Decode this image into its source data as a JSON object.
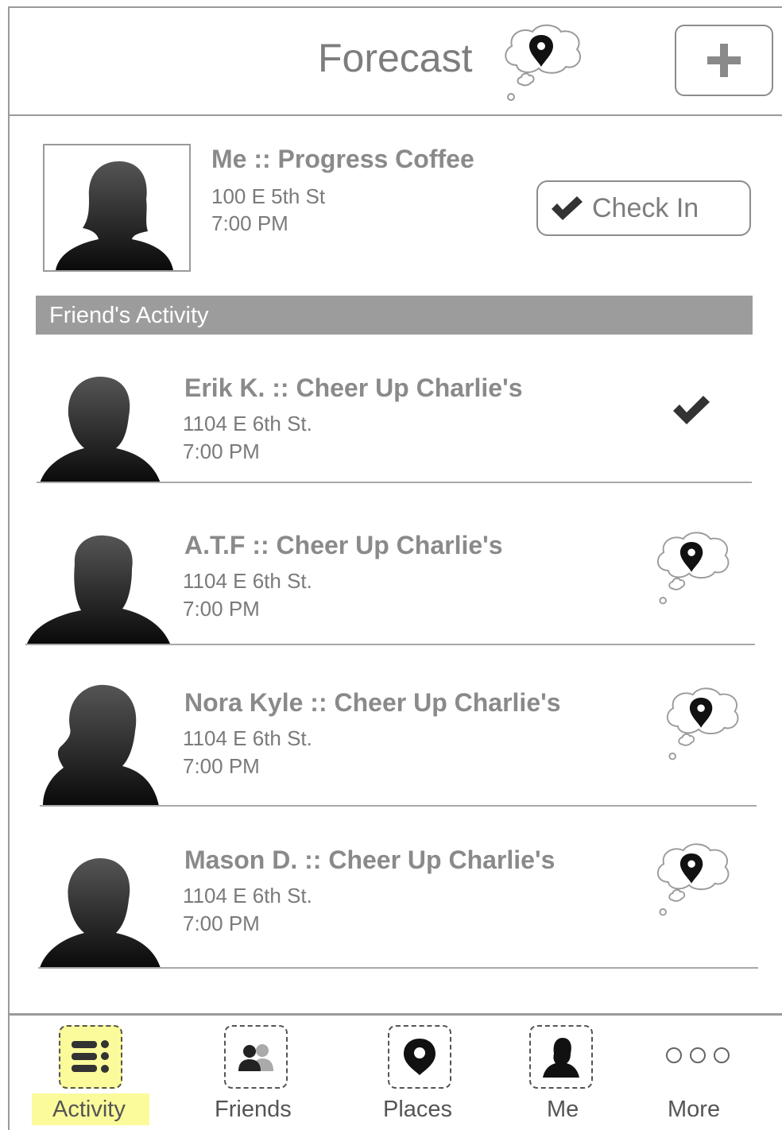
{
  "header": {
    "title": "Forecast"
  },
  "me": {
    "title": "Me :: Progress Coffee",
    "address": "100 E 5th St",
    "time": "7:00 PM",
    "checkin_label": "Check In"
  },
  "section": {
    "label": "Friend's Activity"
  },
  "friends": [
    {
      "title": "Erik K. :: Cheer Up Charlie's",
      "address": "1104 E 6th St.",
      "time": "7:00 PM",
      "status": "checkmark-icon"
    },
    {
      "title": "A.T.F :: Cheer Up Charlie's",
      "address": "1104 E 6th St.",
      "time": "7:00 PM",
      "status": "thought-cloud-pin-icon"
    },
    {
      "title": "Nora Kyle :: Cheer Up Charlie's",
      "address": "1104 E 6th St.",
      "time": "7:00 PM",
      "status": "thought-cloud-pin-icon"
    },
    {
      "title": "Mason D. :: Cheer Up Charlie's",
      "address": "1104 E 6th St.",
      "time": "7:00 PM",
      "status": "thought-cloud-pin-icon"
    }
  ],
  "nav": [
    {
      "label": "Activity",
      "icon": "list-icon",
      "active": true
    },
    {
      "label": "Friends",
      "icon": "friends-icon",
      "active": false
    },
    {
      "label": "Places",
      "icon": "map-pin-icon",
      "active": false
    },
    {
      "label": "Me",
      "icon": "person-icon",
      "active": false
    },
    {
      "label": "More",
      "icon": "more-dots-icon",
      "active": false
    }
  ],
  "colors": {
    "active_highlight": "#fbfb9b",
    "section_bar": "#9c9c9c",
    "text_gray": "#8a8a8a"
  }
}
